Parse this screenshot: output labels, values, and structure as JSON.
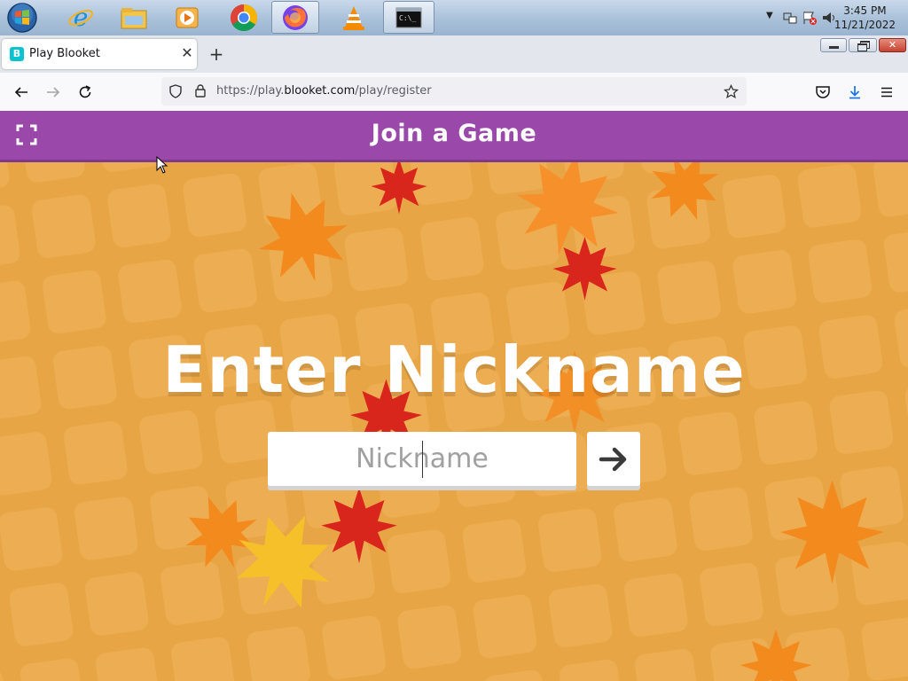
{
  "taskbar": {
    "apps": [
      "internet-explorer",
      "file-explorer",
      "media-player",
      "chrome",
      "firefox",
      "vlc",
      "command-prompt"
    ],
    "clock": {
      "time": "3:45 PM",
      "date": "11/21/2022"
    }
  },
  "browser": {
    "tab": {
      "title": "Play Blooket",
      "favicon_letter": "B"
    },
    "url": {
      "prefix": "https://play.",
      "domain": "blooket.com",
      "path": "/play/register"
    }
  },
  "page": {
    "header_title": "Join a Game",
    "heading": "Enter Nickname",
    "nickname_placeholder": "Nickname",
    "nickname_value": ""
  },
  "colors": {
    "header": "#9a49aa",
    "background": "#e8a545",
    "leaf_orange": "#f28a1e",
    "leaf_red": "#d9261c",
    "leaf_yellow": "#f5c02a"
  }
}
